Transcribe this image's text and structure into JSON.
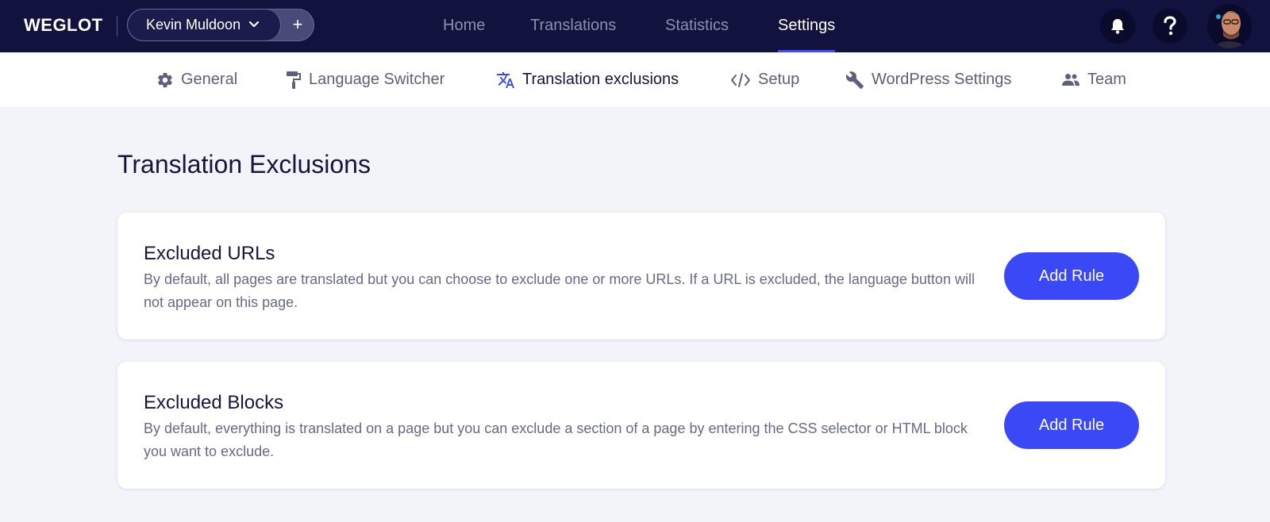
{
  "header": {
    "logo": "WEGLOT",
    "project": {
      "name": "Kevin Muldoon",
      "add_label": "+"
    },
    "nav": [
      {
        "label": "Home",
        "active": false
      },
      {
        "label": "Translations",
        "active": false
      },
      {
        "label": "Statistics",
        "active": false
      },
      {
        "label": "Settings",
        "active": true
      }
    ],
    "icons": [
      "bell-icon",
      "help-icon",
      "user-avatar"
    ]
  },
  "subnav": {
    "items": [
      {
        "label": "General",
        "icon": "gear-icon",
        "active": false
      },
      {
        "label": "Language Switcher",
        "icon": "paint-roller-icon",
        "active": false
      },
      {
        "label": "Translation exclusions",
        "icon": "translate-icon",
        "active": true
      },
      {
        "label": "Setup",
        "icon": "code-icon",
        "active": false
      },
      {
        "label": "WordPress Settings",
        "icon": "wrench-icon",
        "active": false
      },
      {
        "label": "Team",
        "icon": "people-icon",
        "active": false
      }
    ]
  },
  "main": {
    "title": "Translation Exclusions",
    "cards": [
      {
        "title": "Excluded URLs",
        "description": "By default, all pages are translated but you can choose to exclude one or more URLs. If a URL is excluded, the language button will not appear on this page.",
        "button": "Add Rule"
      },
      {
        "title": "Excluded Blocks",
        "description": "By default, everything is translated on a page but you can exclude a section of a page by entering the CSS selector or HTML block you want to exclude.",
        "button": "Add Rule"
      }
    ]
  },
  "colors": {
    "topbar": "#12123f",
    "accent": "#3a49f5",
    "page_bg": "#f2f4fa"
  }
}
